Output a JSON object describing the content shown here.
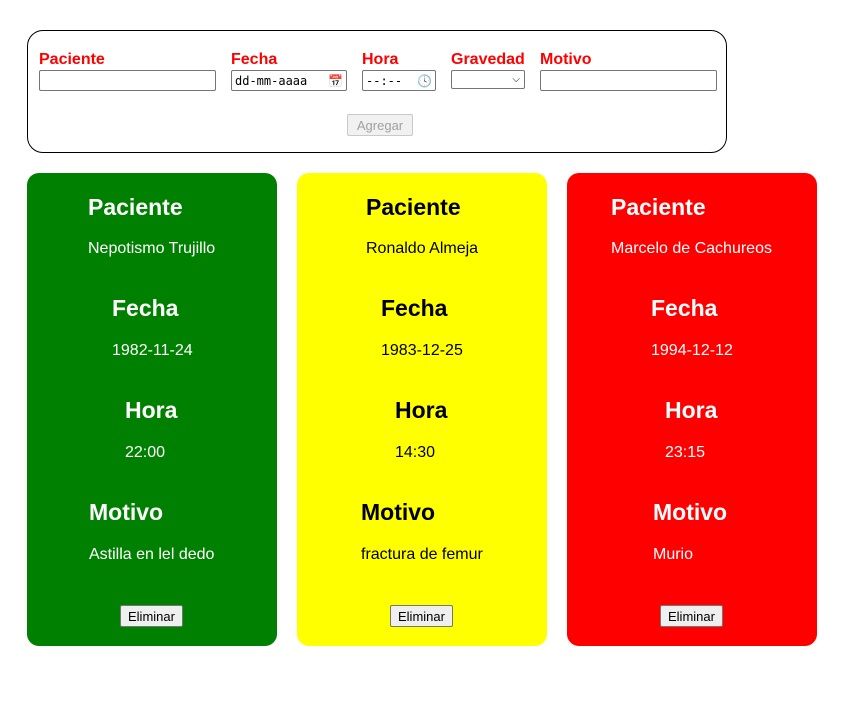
{
  "form": {
    "paciente": {
      "label": "Paciente",
      "value": ""
    },
    "fecha": {
      "label": "Fecha",
      "placeholder": "dd-mm-aaaa"
    },
    "hora": {
      "label": "Hora",
      "placeholder": "--:--"
    },
    "gravedad": {
      "label": "Gravedad",
      "value": ""
    },
    "motivo": {
      "label": "Motivo",
      "value": ""
    },
    "add_label": "Agregar"
  },
  "labels": {
    "paciente": "Paciente",
    "fecha": "Fecha",
    "hora": "Hora",
    "motivo": "Motivo"
  },
  "delete_label": "Eliminar",
  "cards": [
    {
      "color": "#008000",
      "paciente": "Nepotismo Trujillo",
      "fecha": "1982-11-24",
      "hora": "22:00",
      "motivo": "Astilla en lel dedo"
    },
    {
      "color": "#ffff00",
      "paciente": "Ronaldo Almeja",
      "fecha": "1983-12-25",
      "hora": "14:30",
      "motivo": "fractura de femur"
    },
    {
      "color": "#ff0000",
      "paciente": "Marcelo de Cachureos",
      "fecha": "1994-12-12",
      "hora": "23:15",
      "motivo": "Murio"
    }
  ]
}
